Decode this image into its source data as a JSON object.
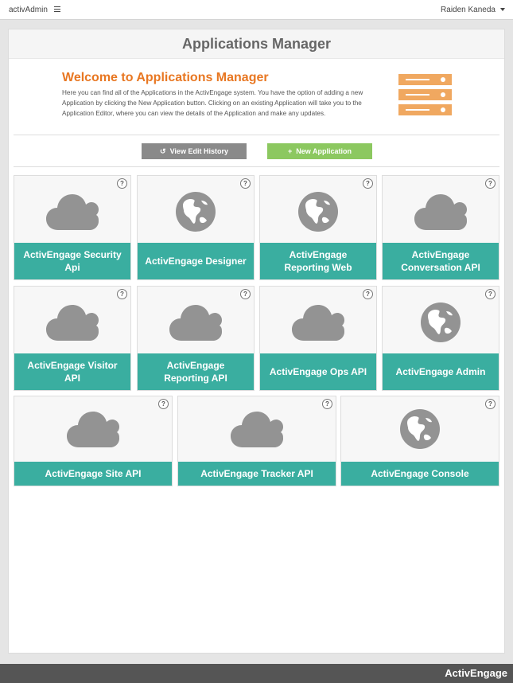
{
  "topbar": {
    "brand": "activAdmin",
    "menu_icon": "hamburger-icon",
    "user_name": "Raiden Kaneda"
  },
  "panel": {
    "title": "Applications Manager",
    "welcome_title": "Welcome to Applications Manager",
    "welcome_text": "Here you can find all of the Applications in the ActivEngage system. You have the option of adding a new Application by clicking the New Application button. Clicking on an existing Application will take you to the Application Editor, where you can view the details of the Application and make any updates.",
    "header_icon": "server-icon",
    "view_history_label": "View Edit History",
    "new_app_label": "New Application"
  },
  "colors": {
    "accent_orange": "#e87722",
    "tile_teal": "#3aaea0",
    "new_button_green": "#8cc860",
    "history_button_gray": "#8a8a8a"
  },
  "apps": [
    {
      "label": "ActivEngage Security Api",
      "icon": "cloud-icon"
    },
    {
      "label": "ActivEngage Designer",
      "icon": "globe-icon"
    },
    {
      "label": "ActivEngage Reporting Web",
      "icon": "globe-icon"
    },
    {
      "label": "ActivEngage Conversation API",
      "icon": "cloud-icon"
    },
    {
      "label": "ActivEngage Visitor API",
      "icon": "cloud-icon"
    },
    {
      "label": "ActivEngage Reporting API",
      "icon": "cloud-icon"
    },
    {
      "label": "ActivEngage Ops API",
      "icon": "cloud-icon"
    },
    {
      "label": "ActivEngage Admin",
      "icon": "globe-icon"
    },
    {
      "label": "ActivEngage Site API",
      "icon": "cloud-icon"
    },
    {
      "label": "ActivEngage Tracker API",
      "icon": "cloud-icon"
    },
    {
      "label": "ActivEngage Console",
      "icon": "globe-icon"
    }
  ],
  "help_label": "?",
  "footer": {
    "brand": "ActivEngage"
  }
}
